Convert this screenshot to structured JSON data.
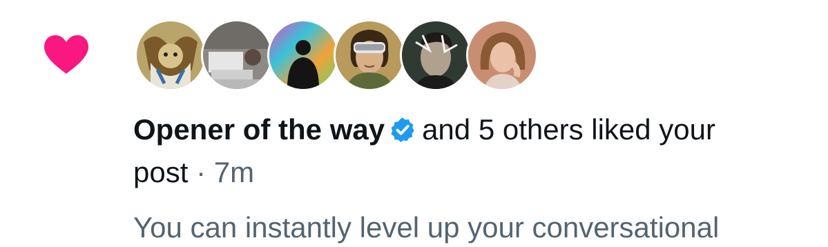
{
  "notification": {
    "type_icon": "heart-icon",
    "icon_color": "#f91880",
    "actor_name": "Opener of the way",
    "verified_icon": "verified-badge-icon",
    "verified_color": "#1d9bf0",
    "action_text": "and 5 others liked your",
    "action_text_cont": "post",
    "separator": "·",
    "timestamp": "7m",
    "post_preview": "You can instantly level up your conversational",
    "avatars": [
      {
        "name": "avatar-1-cat-art"
      },
      {
        "name": "avatar-2-office"
      },
      {
        "name": "avatar-3-colorful-silhouette"
      },
      {
        "name": "avatar-4-vr-headset"
      },
      {
        "name": "avatar-5-glitch-portrait"
      },
      {
        "name": "avatar-6-woman-portrait"
      }
    ]
  }
}
